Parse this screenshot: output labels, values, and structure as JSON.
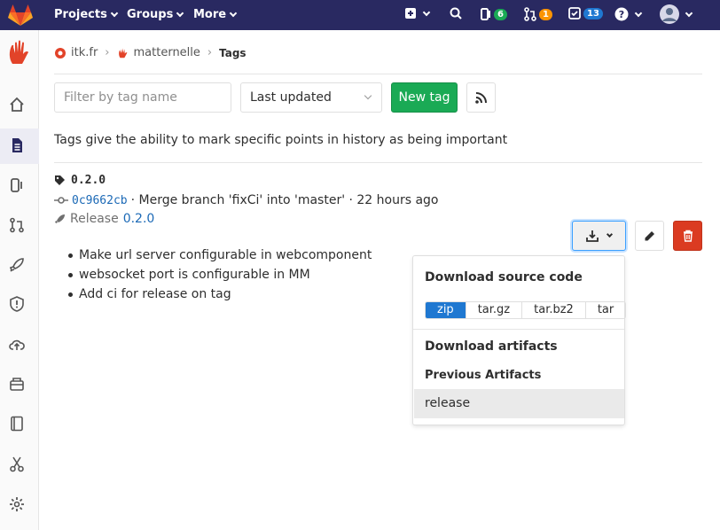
{
  "topnav": {
    "projects": "Projects",
    "groups": "Groups",
    "more": "More",
    "issues_count": "6",
    "mr_count": "1",
    "todos_count": "13",
    "colors": {
      "bar": "#292961",
      "issues_badge": "#1aaa55",
      "mr_badge": "#fc9403",
      "todos_badge": "#1f78d1"
    }
  },
  "breadcrumb": {
    "group": "itk.fr",
    "project": "matternelle",
    "current": "Tags"
  },
  "toolbar": {
    "filter_placeholder": "Filter by tag name",
    "sort_value": "Last updated",
    "new_tag": "New tag"
  },
  "description": "Tags give the ability to mark specific points in history as being important",
  "tag": {
    "name": "0.2.0",
    "commit_sha": "0c9662cb",
    "commit_message": "· Merge branch 'fixCi' into 'master' · 22 hours ago",
    "release_label": "Release",
    "release_link": "0.2.0",
    "notes": [
      "Make url server configurable in webcomponent",
      "websocket port is configurable in MM",
      "Add ci for release on tag"
    ]
  },
  "download_menu": {
    "source_title": "Download source code",
    "formats": [
      "zip",
      "tar.gz",
      "tar.bz2",
      "tar"
    ],
    "selected_format": "zip",
    "artifacts_title": "Download artifacts",
    "previous_title": "Previous Artifacts",
    "artifact_item": "release"
  },
  "icons": [
    "gitlab-logo-icon",
    "plus-icon",
    "search-icon",
    "issues-icon",
    "merge-request-icon",
    "todo-icon",
    "help-icon",
    "avatar",
    "project-logo-icon",
    "home-icon",
    "repository-icon",
    "issues-icon",
    "merge-request-icon",
    "rocket-icon",
    "shield-icon",
    "cloud-icon",
    "package-icon",
    "book-icon",
    "scissors-icon",
    "settings-icon",
    "tag-icon",
    "commit-icon",
    "download-icon",
    "pencil-icon",
    "trash-icon",
    "rss-icon"
  ]
}
